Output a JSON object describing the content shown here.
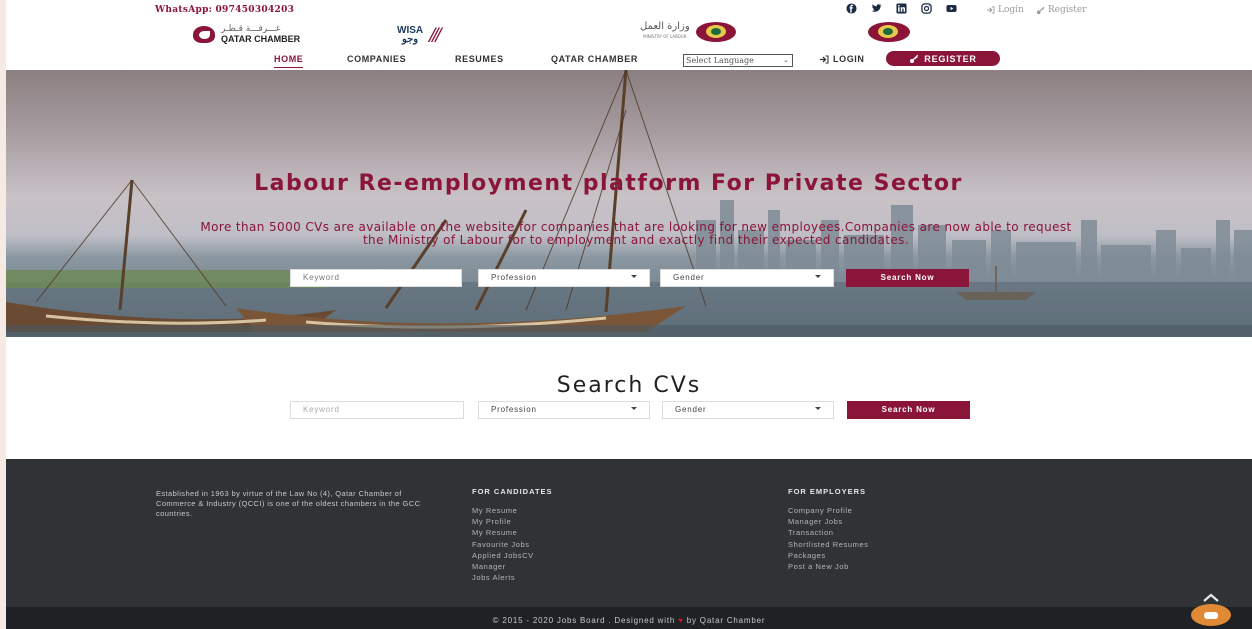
{
  "topbar": {
    "whatsapp_label": "WhatsApp:",
    "whatsapp_number": "097450304203",
    "login": "Login",
    "register": "Register"
  },
  "logos": {
    "qatar_chamber_ar": "غـــرفـــة قـطـر",
    "qatar_chamber_en": "QATAR CHAMBER",
    "wisa_en": "WISA",
    "wisa_ar": "وجو",
    "ministry_ar": "وزارة العمل",
    "ministry_en": "MINISTRY OF LABOUR"
  },
  "nav": {
    "items": [
      "HOME",
      "COMPANIES",
      "RESUMES",
      "QATAR CHAMBER"
    ],
    "language": "Select Language",
    "login": "LOGIN",
    "register": "REGISTER"
  },
  "hero": {
    "title": "Labour Re-employment platform For Private Sector",
    "subtitle": "More than 5000 CVs are available on the website for companies that are looking for new employees.Companies are now able to request the Ministry of Labour for to employment and exactly find their expected candidates."
  },
  "search": {
    "keyword_placeholder": "Keyword",
    "profession": "Profession",
    "gender": "Gender",
    "button": "Search Now"
  },
  "cvs": {
    "title": "Search CVs"
  },
  "footer": {
    "about": "Established in 1963 by virtue of the Law No (4), Qatar Chamber of Commerce & Industry (QCCI) is one of the oldest chambers in the GCC countries.",
    "candidates_heading": "FOR CANDIDATES",
    "candidates": [
      "My Resume",
      "My Profile",
      "My Resume",
      "Favourite Jobs",
      "Applied JobsCV",
      "Manager",
      "Jobs Alerts"
    ],
    "employers_heading": "FOR EMPLOYERS",
    "employers": [
      "Company Profile",
      "Manager Jobs",
      "Transaction",
      "Shortlisted Resumes",
      "Packages",
      "Post a New Job"
    ],
    "copyright_pre": "© 2015 - 2020 Jobs Board . Designed with",
    "copyright_post": "by Qatar Chamber"
  },
  "colors": {
    "brand": "#8a1538",
    "footer_bg": "#2f3335",
    "chat_button": "#e08a36"
  }
}
